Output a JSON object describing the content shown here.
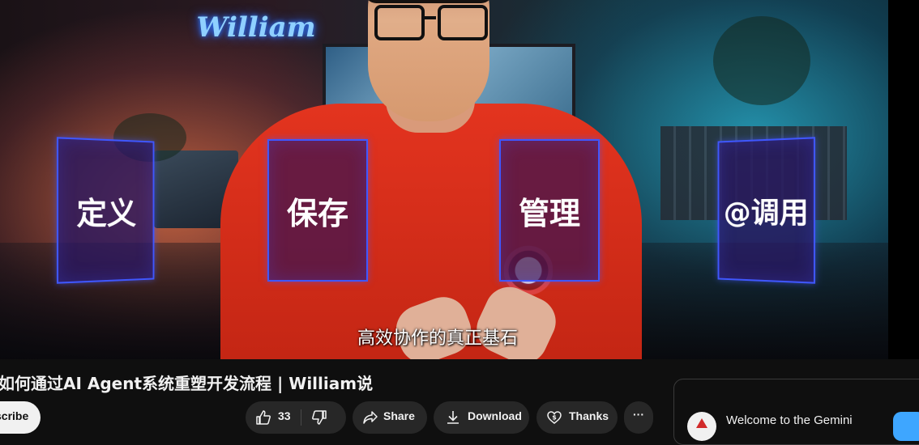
{
  "video": {
    "watermark": "William",
    "panels": [
      "定义",
      "保存",
      "管理",
      "@调用"
    ],
    "subtitle": "高效协作的真正基石"
  },
  "title": "如何通过AI Agent系统重塑开发流程 | William说",
  "actions": {
    "subscribe_label": "Subscribe",
    "subscribe_visible": "scribe",
    "like_count": "33",
    "share_label": "Share",
    "download_label": "Download",
    "thanks_label": "Thanks",
    "more_label": "···"
  },
  "chat": {
    "welcome": "Welcome to the Gemini"
  },
  "icons": {
    "like": "thumbs-up-icon",
    "dislike": "thumbs-down-icon",
    "share": "share-arrow-icon",
    "download": "download-icon",
    "thanks": "heart-dollar-icon",
    "more": "more-horizontal-icon"
  },
  "colors": {
    "page_bg": "#0f0f0f",
    "pill_bg": "#272727",
    "panel_border": "#3f57ff",
    "accent_blue": "#3ea6ff"
  }
}
